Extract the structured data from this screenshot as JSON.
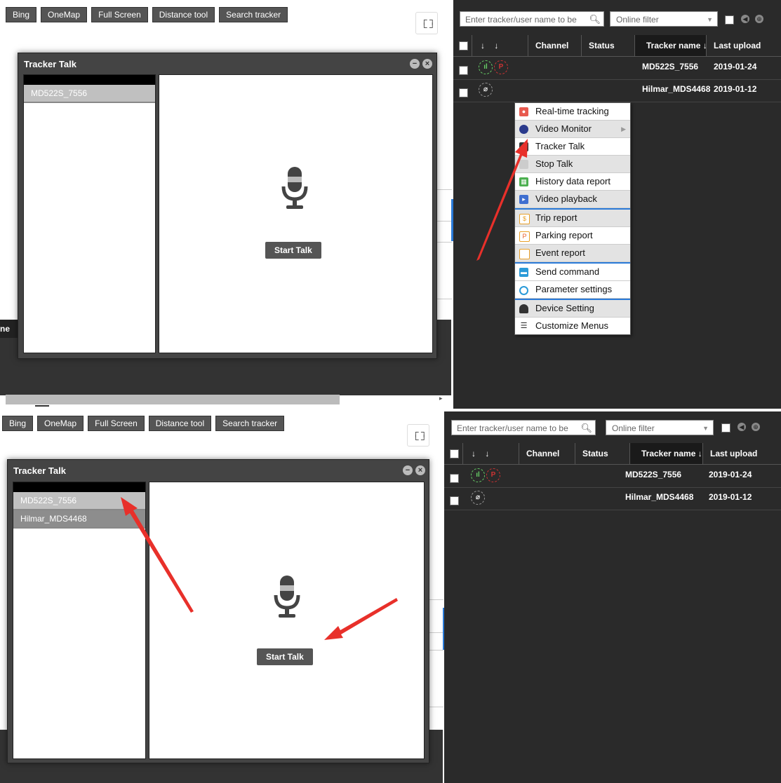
{
  "toolbar": {
    "buttons": [
      "Bing",
      "OneMap",
      "Full Screen",
      "Distance tool",
      "Search tracker"
    ],
    "fullscreen_icon": "expand-icon"
  },
  "dialog": {
    "title": "Tracker Talk",
    "minimize_icon": "minus-circle-icon",
    "close_icon": "close-circle-icon",
    "mic_icon": "microphone-icon",
    "start_label": "Start Talk"
  },
  "left_panel_partial_label": "ne",
  "tracker_panel": {
    "search_placeholder": "Enter tracker/user name to be",
    "search_icon": "search-icon",
    "filter_value": "Online filter",
    "columns": [
      "Channel",
      "Status",
      "Tracker name ↓",
      "Last upload"
    ],
    "sort_arrows": [
      "↓",
      "↓"
    ],
    "rows": [
      {
        "name": "MD522S_7556",
        "last_upload": "2019-01-24",
        "status_icons": [
          "signal-icon",
          "parking-icon"
        ]
      },
      {
        "name": "Hilmar_MDS4468",
        "last_upload": "2019-01-12",
        "status_icons": [
          "offline-icon"
        ]
      }
    ]
  },
  "screenshot1": {
    "talk_list": [
      "MD522S_7556"
    ]
  },
  "screenshot2": {
    "talk_list": [
      "MD522S_7556",
      "Hilmar_MDS4468"
    ]
  },
  "context_menu": {
    "items": [
      {
        "label": "Real-time tracking",
        "icon": "map-pin-icon",
        "color": "#e85a4f"
      },
      {
        "label": "Video Monitor",
        "icon": "camera-icon",
        "color": "#2b3a8c",
        "submenu": true
      },
      {
        "label": "Tracker Talk",
        "icon": "microphone-icon",
        "color": "#333333"
      },
      {
        "label": "Stop Talk",
        "icon": "stop-icon",
        "color": "#777777"
      },
      {
        "label": "History data report",
        "icon": "map-report-icon",
        "color": "#4caf50"
      },
      {
        "label": "Video playback",
        "icon": "video-icon",
        "color": "#3f6fd0"
      },
      {
        "label": "Trip report",
        "icon": "trip-report-icon",
        "color": "#e8a02a"
      },
      {
        "label": "Parking report",
        "icon": "parking-report-icon",
        "color": "#e8a02a"
      },
      {
        "label": "Event report",
        "icon": "event-report-icon",
        "color": "#e8a02a"
      },
      {
        "label": "Send command",
        "icon": "command-icon",
        "color": "#2a9ad8"
      },
      {
        "label": "Parameter settings",
        "icon": "settings-circle-icon",
        "color": "#2a9ad8"
      },
      {
        "label": "Device Setting",
        "icon": "user-device-icon",
        "color": "#333333"
      },
      {
        "label": "Customize Menus",
        "icon": "menu-lines-icon",
        "color": "#333333"
      }
    ]
  },
  "colors": {
    "panel_dark": "#2a2a2a",
    "button_dark": "#555555",
    "accent_blue": "#2a7ad8",
    "arrow_red": "#e8302a"
  }
}
